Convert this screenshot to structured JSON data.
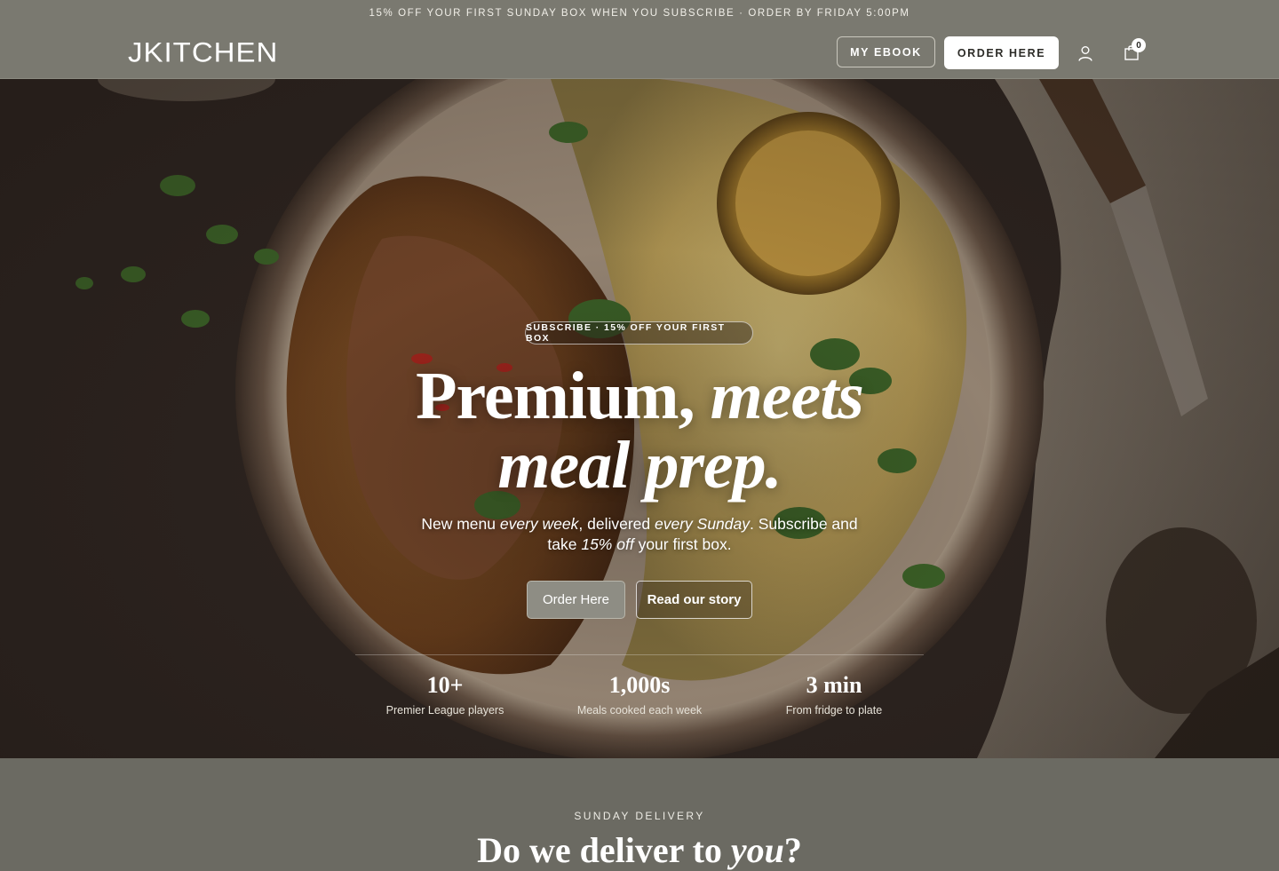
{
  "announcement": "15% OFF YOUR FIRST SUNDAY BOX WHEN YOU SUBSCRIBE · ORDER BY FRIDAY 5:00PM",
  "header": {
    "logo": "JKITCHEN",
    "ebook_label": "MY EBOOK",
    "order_label": "ORDER HERE",
    "cart_count": "0",
    "icons": [
      "user-icon",
      "shopping-bag-icon"
    ]
  },
  "hero": {
    "pill": "SUBSCRIBE · 15% OFF YOUR FIRST BOX",
    "headline_plain": "Premium,",
    "headline_em1": "meets",
    "headline_em2": "meal prep.",
    "sub_1": "New menu ",
    "sub_em1": "every week",
    "sub_2": ", delivered ",
    "sub_em2": "every Sunday",
    "sub_3": ". Subscribe and take ",
    "sub_em3": "15% off",
    "sub_4": " your first box.",
    "primary_button": "Order Here",
    "secondary_button": "Read our story",
    "stats": [
      {
        "value": "10+",
        "label": "Premier League players"
      },
      {
        "value": "1,000s",
        "label": "Meals cooked each week"
      },
      {
        "value": "3 min",
        "label": "From fridge to plate"
      }
    ]
  },
  "delivery": {
    "kicker": "SUNDAY DELIVERY",
    "title_1": "Do we deliver to ",
    "title_em": "you",
    "title_2": "?"
  },
  "colors": {
    "header_bg": "#7a7970",
    "section_bg": "#6b6a62",
    "primary_button": "#8e8d84"
  }
}
